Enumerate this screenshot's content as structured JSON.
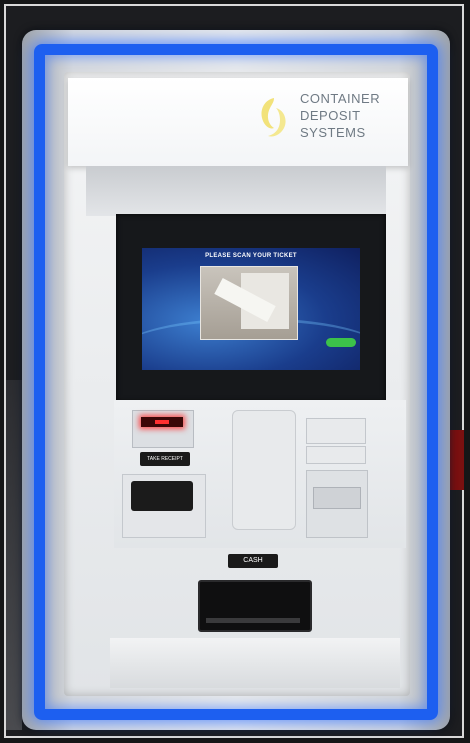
{
  "sign": {
    "brand_lines": [
      "CONTAINER",
      "DEPOSIT",
      "SYSTEMS"
    ]
  },
  "screen": {
    "prompt": "PLEASE SCAN YOUR TICKET"
  },
  "labels": {
    "receipt": "TAKE RECEIPT",
    "cash": "CASH"
  },
  "colors": {
    "accent_light": "#1d5ff0",
    "display_blue": "#1a3d8c",
    "button_green": "#3cc24a",
    "led_red": "#ff3030"
  }
}
